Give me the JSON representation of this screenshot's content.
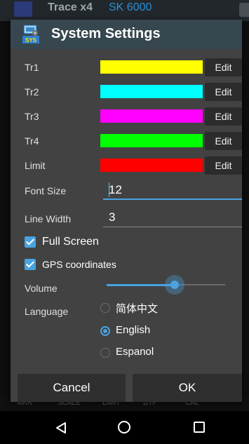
{
  "background": {
    "title": "Trace x4",
    "subtitle": "SK 6000",
    "bottom_tabs": [
      "MKR",
      "SCALE",
      "LIMIT",
      "DTF",
      "CAL"
    ]
  },
  "dialog": {
    "title": "System Settings",
    "icon_text": "SYS",
    "edit_label": "Edit",
    "colors": [
      {
        "label": "Tr1",
        "color": "#ffff00"
      },
      {
        "label": "Tr2",
        "color": "#00ffff"
      },
      {
        "label": "Tr3",
        "color": "#ff00ff"
      },
      {
        "label": "Tr4",
        "color": "#00ff00"
      },
      {
        "label": "Limit",
        "color": "#ff0000"
      }
    ],
    "font_size": {
      "label": "Font Size",
      "value": "12"
    },
    "line_width": {
      "label": "Line Width",
      "value": "3"
    },
    "full_screen": {
      "label": "Full Screen",
      "checked": true
    },
    "gps": {
      "label": "GPS coordinates",
      "checked": true
    },
    "volume": {
      "label": "Volume",
      "level_fraction": 0.55
    },
    "language": {
      "label": "Language",
      "options": [
        "简体中文",
        "English",
        "Espanol"
      ],
      "selected": "English"
    },
    "cancel_label": "Cancel",
    "ok_label": "OK"
  },
  "accent_color": "#4aa3e0"
}
